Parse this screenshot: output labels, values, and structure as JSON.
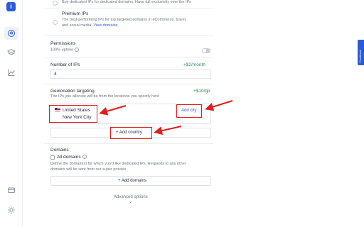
{
  "sidebar": {
    "logo": "i",
    "icons": [
      "location-icon",
      "layers-icon",
      "chart-icon",
      "billing-icon",
      "settings-icon"
    ]
  },
  "plans": {
    "dedicated_desc": "Buy dedicated IPs for dedicated domains. Have full exclusivity over the IPs",
    "premium_title": "Premium IPs",
    "premium_desc_1": "The best-performing IPs for top targeted domains in eCommerce, travel,",
    "premium_desc_2": "and social media.",
    "premium_link": "View domains"
  },
  "permissions": {
    "label": "Permissions",
    "uptime": "100% uptime"
  },
  "ips": {
    "label": "Number of IPs",
    "price": "+$2/month",
    "value": "4"
  },
  "geo": {
    "label": "Geolocation targeting",
    "price": "+$10/gb",
    "desc": "The IPs you allocate will be from the locations you specify here",
    "country": "United States",
    "city": "New York City",
    "add_city": "Add city",
    "add_country": "Add country"
  },
  "domains": {
    "label": "Domains",
    "all_domains": "All domains",
    "desc_1": "Define the domain(s) for which you'd like dedicated IPs. Requests to any other",
    "desc_2": "domains will be sent from our super proxies",
    "add_domains": "Add domains"
  },
  "advanced": "Advanced options",
  "feedback": "Feedback",
  "colors": {
    "accent": "#2a5bd7",
    "annotation": "#e21d1d",
    "price": "#2e8f5a"
  }
}
